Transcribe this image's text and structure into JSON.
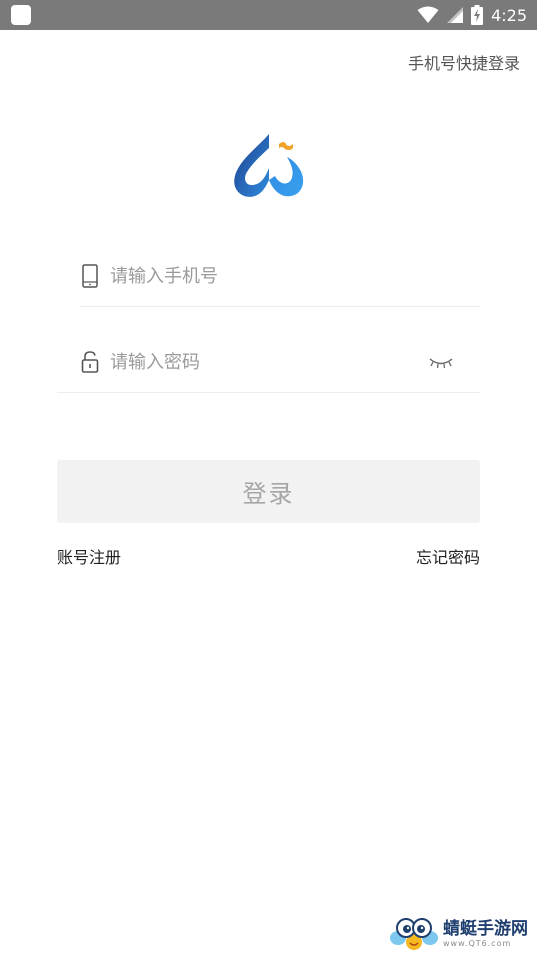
{
  "status_bar": {
    "time": "4:25",
    "icons": [
      "app-notification-icon",
      "wifi-icon",
      "signal-icon",
      "battery-charging-icon"
    ]
  },
  "header": {
    "quick_login_label": "手机号快捷登录"
  },
  "logo": {
    "icon": "brand-logo-icon",
    "colors": {
      "primary": "#2c7fd0",
      "dark": "#1f3f8a",
      "accent": "#f0a32a"
    }
  },
  "form": {
    "phone": {
      "placeholder": "请输入手机号",
      "value": "",
      "icon": "phone-icon"
    },
    "password": {
      "placeholder": "请输入密码",
      "value": "",
      "icon": "lock-icon",
      "toggle_icon": "eye-closed-icon"
    },
    "login_label": "登录"
  },
  "links": {
    "register": "账号注册",
    "forgot": "忘记密码"
  },
  "watermark": {
    "name": "蜻蜓手游网",
    "url": "www.QT6.com"
  }
}
